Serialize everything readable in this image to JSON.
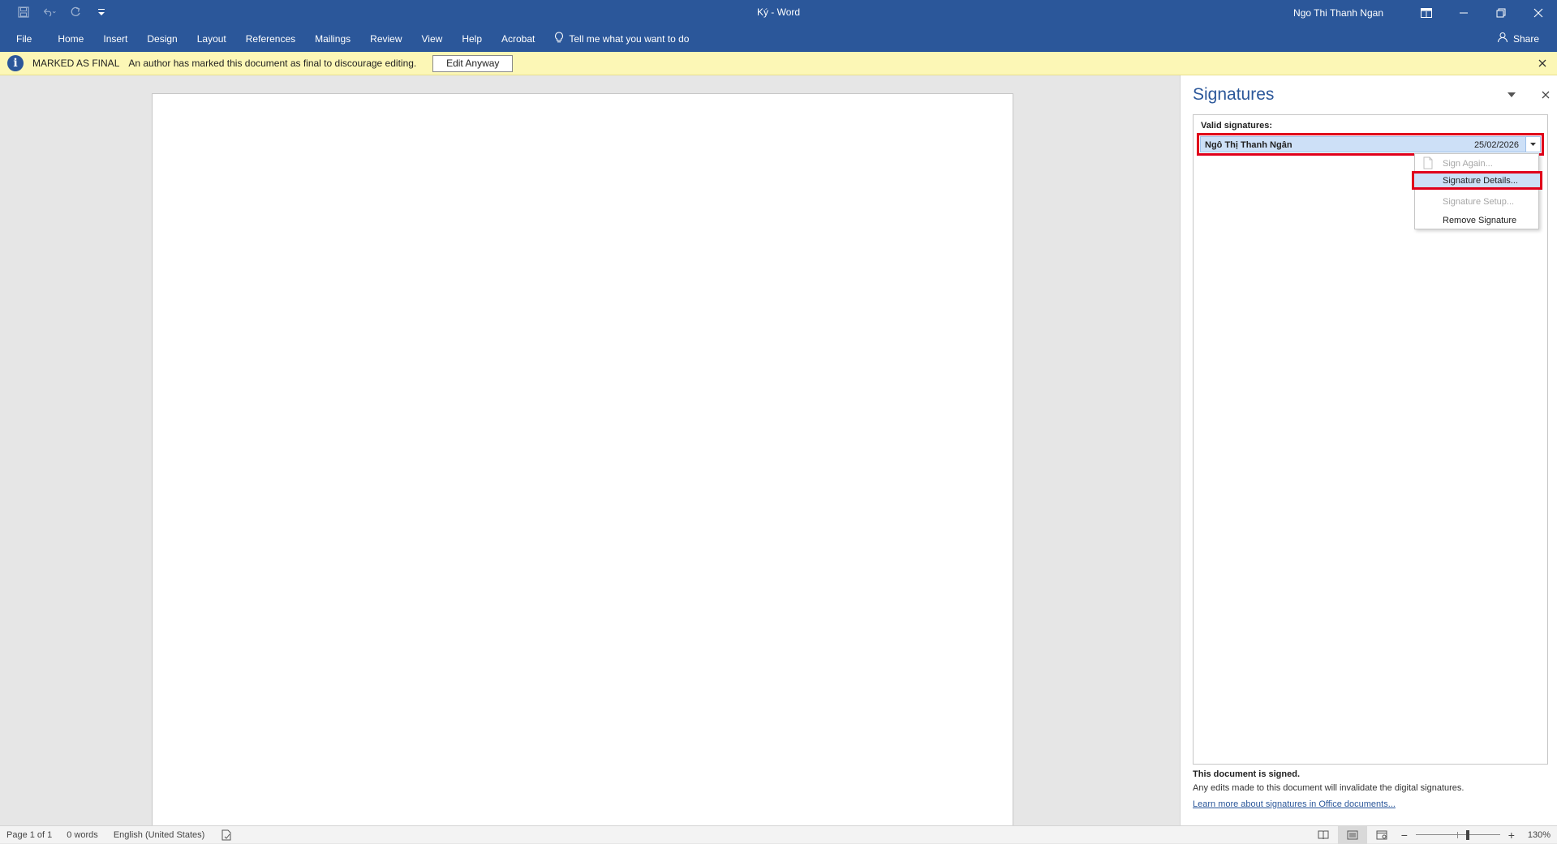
{
  "window": {
    "title": "Ký  -  Word",
    "user": "Ngo Thi Thanh Ngan"
  },
  "ribbon": {
    "tabs": [
      "File",
      "Home",
      "Insert",
      "Design",
      "Layout",
      "References",
      "Mailings",
      "Review",
      "View",
      "Help",
      "Acrobat"
    ],
    "tell_me": "Tell me what you want to do",
    "share": "Share"
  },
  "message_bar": {
    "title": "MARKED AS FINAL",
    "text": "An author has marked this document as final to discourage editing.",
    "button": "Edit Anyway"
  },
  "signatures_pane": {
    "title": "Signatures",
    "section_label": "Valid signatures:",
    "signature": {
      "name": "Ngô Thị Thanh Ngân",
      "date": "25/02/2026"
    },
    "menu": [
      {
        "label": "Sign Again...",
        "disabled": true
      },
      {
        "label": "Signature Details...",
        "disabled": false,
        "selected": true
      },
      {
        "label": "Signature Setup...",
        "disabled": true
      },
      {
        "label": "Remove Signature",
        "disabled": false
      }
    ],
    "footer_bold": "This document is signed.",
    "footer_text": "Any edits made to this document will invalidate the digital signatures.",
    "footer_link": "Learn more about signatures in Office documents..."
  },
  "status": {
    "page": "Page 1 of 1",
    "words": "0 words",
    "language": "English (United States)",
    "zoom": "130%"
  },
  "colors": {
    "brand": "#2b579a",
    "message_bar": "#fcf7b6",
    "highlight_border": "#e0001b",
    "selection": "#cde0f7"
  }
}
